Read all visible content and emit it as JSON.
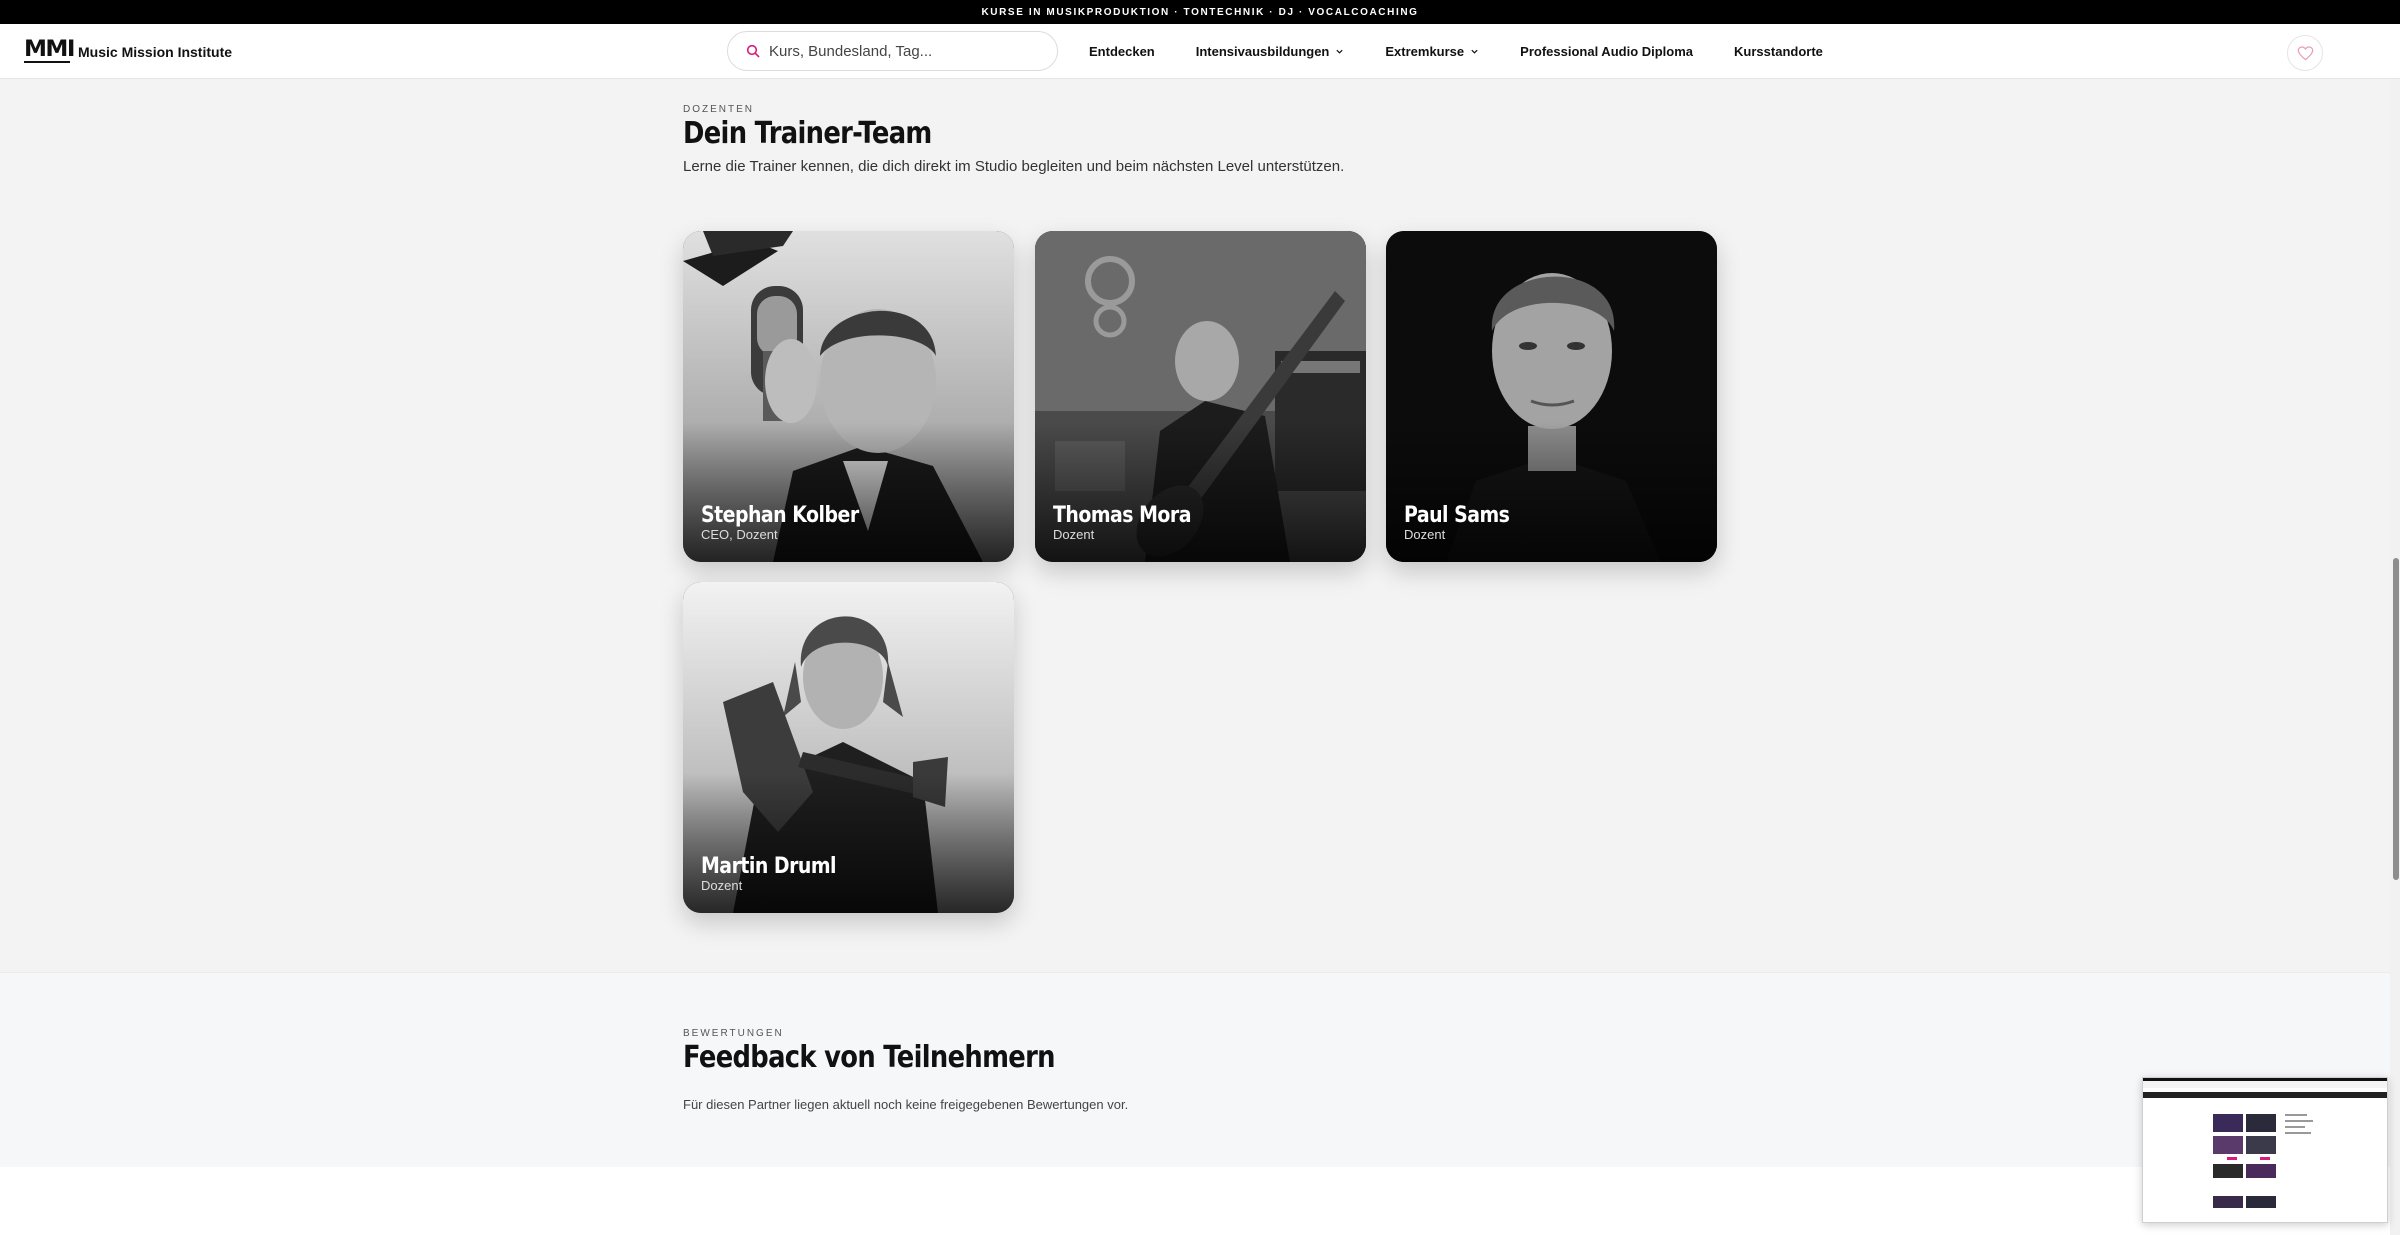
{
  "announcement": "KURSE IN MUSIKPRODUKTION · TONTECHNIK · DJ · VOCALCOACHING",
  "header": {
    "logo_mark": "MMI",
    "brand_name": "Music Mission Institute",
    "search_placeholder": "Kurs, Bundesland, Tag...",
    "nav": {
      "entdecken": "Entdecken",
      "intensiv": "Intensivausbildungen",
      "extrem": "Extremkurse",
      "diploma": "Professional Audio Diploma",
      "standorte": "Kursstandorte"
    },
    "icons": {
      "search": "search-icon",
      "chevron": "chevron-down-icon",
      "favorites": "heart-icon"
    },
    "accent_color": "#d81b7a"
  },
  "trainers": {
    "eyebrow": "DOZENTEN",
    "title": "Dein Trainer-Team",
    "lead": "Lerne die Trainer kennen, die dich direkt im Studio begleiten und beim nächsten Level unterstützen.",
    "cards": [
      {
        "name": "Stephan Kolber",
        "role": "CEO, Dozent"
      },
      {
        "name": "Thomas Mora",
        "role": "Dozent"
      },
      {
        "name": "Paul Sams",
        "role": "Dozent"
      },
      {
        "name": "Martin Druml",
        "role": "Dozent"
      }
    ]
  },
  "feedback": {
    "eyebrow": "BEWERTUNGEN",
    "title": "Feedback von Teilnehmern",
    "text": "Für diesen Partner liegen aktuell noch keine freigegebenen Bewertungen vor."
  }
}
